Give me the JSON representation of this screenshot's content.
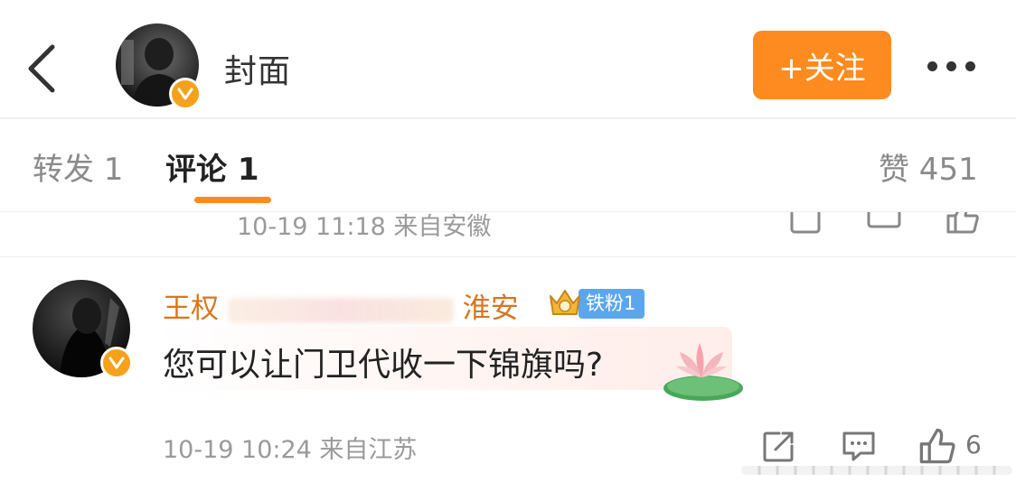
{
  "header": {
    "back_icon": "chevron-left-icon",
    "title": "封面",
    "follow_label": "+关注",
    "more_icon": "more-dots-icon",
    "accent_color": "#fe8b1f"
  },
  "tabs": {
    "repost": "转发 1",
    "comments": "评论 1",
    "likes": "赞 451"
  },
  "previous_comment": {
    "meta": "10-19 11:18 来自安徽"
  },
  "comment": {
    "username": "王权",
    "username_tail": "淮安",
    "fan_badge": "铁粉1",
    "text": "您可以让门卫代收一下锦旗吗?",
    "meta": "10-19 10:24 来自江苏",
    "like_count": "6"
  }
}
